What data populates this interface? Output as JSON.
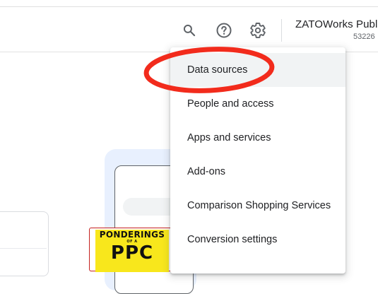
{
  "header": {
    "account_name": "ZATOWorks Publis",
    "account_id": "53226",
    "icons": [
      "search-icon",
      "help-icon",
      "settings-icon"
    ]
  },
  "menu": {
    "items": [
      {
        "label": "Data sources"
      },
      {
        "label": "People and access"
      },
      {
        "label": "Apps and services"
      },
      {
        "label": "Add-ons"
      },
      {
        "label": "Comparison Shopping Services"
      },
      {
        "label": "Conversion settings"
      }
    ]
  },
  "illustration": {
    "book_title": "PONDERINGS",
    "book_subtitle": "OF A",
    "book_big_text": "PPC"
  },
  "colors": {
    "highlight": "#f22b1c",
    "menu_hover": "#f1f3f4",
    "book_yellow": "#f8e71c"
  }
}
